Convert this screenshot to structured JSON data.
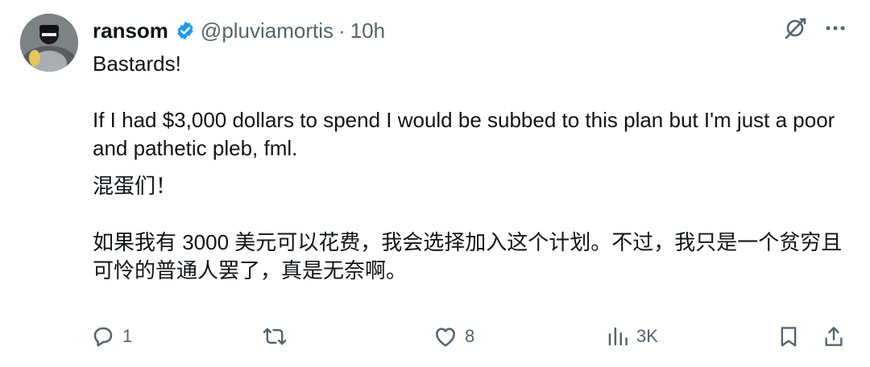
{
  "tweet": {
    "author": {
      "name": "ransom",
      "handle": "@pluviamortis",
      "separator": "·",
      "time": "10h",
      "verified_color": "#1d9bf0"
    },
    "paragraphs": [
      "Bastards!",
      "If I had $3,000 dollars to spend I would be subbed to this plan but I'm just a poor and pathetic pleb, fml.",
      "混蛋们！",
      "如果我有 3000 美元可以花费，我会选择加入这个计划。不过，我只是一个贫穷且可怜的普通人罢了，真是无奈啊。"
    ],
    "stats": {
      "replies": "1",
      "likes": "8",
      "views": "3K"
    },
    "icons": [
      "grok-icon",
      "more-icon",
      "reply-icon",
      "retweet-icon",
      "like-icon",
      "views-icon",
      "bookmark-icon",
      "share-icon"
    ]
  }
}
